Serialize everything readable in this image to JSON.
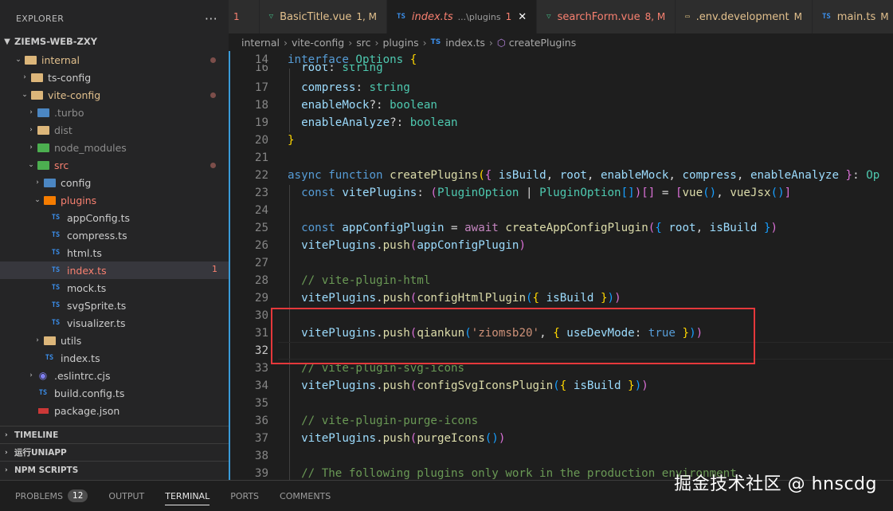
{
  "explorer": {
    "title": "EXPLORER",
    "more": "···",
    "project": "ZIEMS-WEB-ZXY"
  },
  "tree": [
    {
      "label": "internal",
      "kind": "folder"
    },
    {
      "label": "ts-config",
      "kind": "folder"
    },
    {
      "label": "vite-config",
      "kind": "folder"
    },
    {
      "label": ".turbo",
      "kind": "folder"
    },
    {
      "label": "dist",
      "kind": "folder"
    },
    {
      "label": "node_modules",
      "kind": "folder"
    },
    {
      "label": "src",
      "kind": "folder"
    },
    {
      "label": "config",
      "kind": "folder"
    },
    {
      "label": "plugins",
      "kind": "folder"
    },
    {
      "label": "appConfig.ts",
      "kind": "ts"
    },
    {
      "label": "compress.ts",
      "kind": "ts"
    },
    {
      "label": "html.ts",
      "kind": "ts"
    },
    {
      "label": "index.ts",
      "kind": "ts",
      "badge": "1"
    },
    {
      "label": "mock.ts",
      "kind": "ts"
    },
    {
      "label": "svgSprite.ts",
      "kind": "ts"
    },
    {
      "label": "visualizer.ts",
      "kind": "ts"
    },
    {
      "label": "utils",
      "kind": "folder"
    },
    {
      "label": "index.ts",
      "kind": "ts"
    },
    {
      "label": ".eslintrc.cjs",
      "kind": "file"
    },
    {
      "label": "build.config.ts",
      "kind": "ts"
    },
    {
      "label": "package.json",
      "kind": "json"
    }
  ],
  "panels": [
    "TIMELINE",
    "运行UNIAPP",
    "NPM SCRIPTS"
  ],
  "tabs": [
    {
      "label": "",
      "status": "1"
    },
    {
      "label": "BasicTitle.vue",
      "status": "1, M",
      "icon": "vue-icon"
    },
    {
      "label": "index.ts",
      "sub": "...\\plugins",
      "status": "1",
      "icon": "ts-icon",
      "active": true,
      "close": "✕"
    },
    {
      "label": "searchForm.vue",
      "status": "8, M",
      "icon": "vue-icon"
    },
    {
      "label": ".env.development",
      "status": "M",
      "icon": "env-icon"
    },
    {
      "label": "main.ts",
      "status": "M",
      "icon": "ts-icon"
    }
  ],
  "breadcrumb": [
    "internal",
    "vite-config",
    "src",
    "plugins",
    "index.ts",
    "createPlugins"
  ],
  "code": {
    "line_numbers": [
      "14",
      "16",
      "17",
      "18",
      "19",
      "20",
      "21",
      "22",
      "23",
      "24",
      "25",
      "26",
      "27",
      "28",
      "29",
      "30",
      "31",
      "32",
      "33",
      "34",
      "35",
      "36",
      "37",
      "38",
      "39"
    ]
  },
  "bottom_panel": {
    "tabs": [
      "PROBLEMS",
      "OUTPUT",
      "TERMINAL",
      "PORTS",
      "COMMENTS"
    ],
    "problems_count": "12",
    "active": "TERMINAL"
  },
  "watermark": "掘金技术社区 @ hnscdg",
  "colors": {
    "accent": "#3a9bd9",
    "highlight_box": "#e5383b",
    "modified": "#e2c08d",
    "error": "#f88070"
  }
}
